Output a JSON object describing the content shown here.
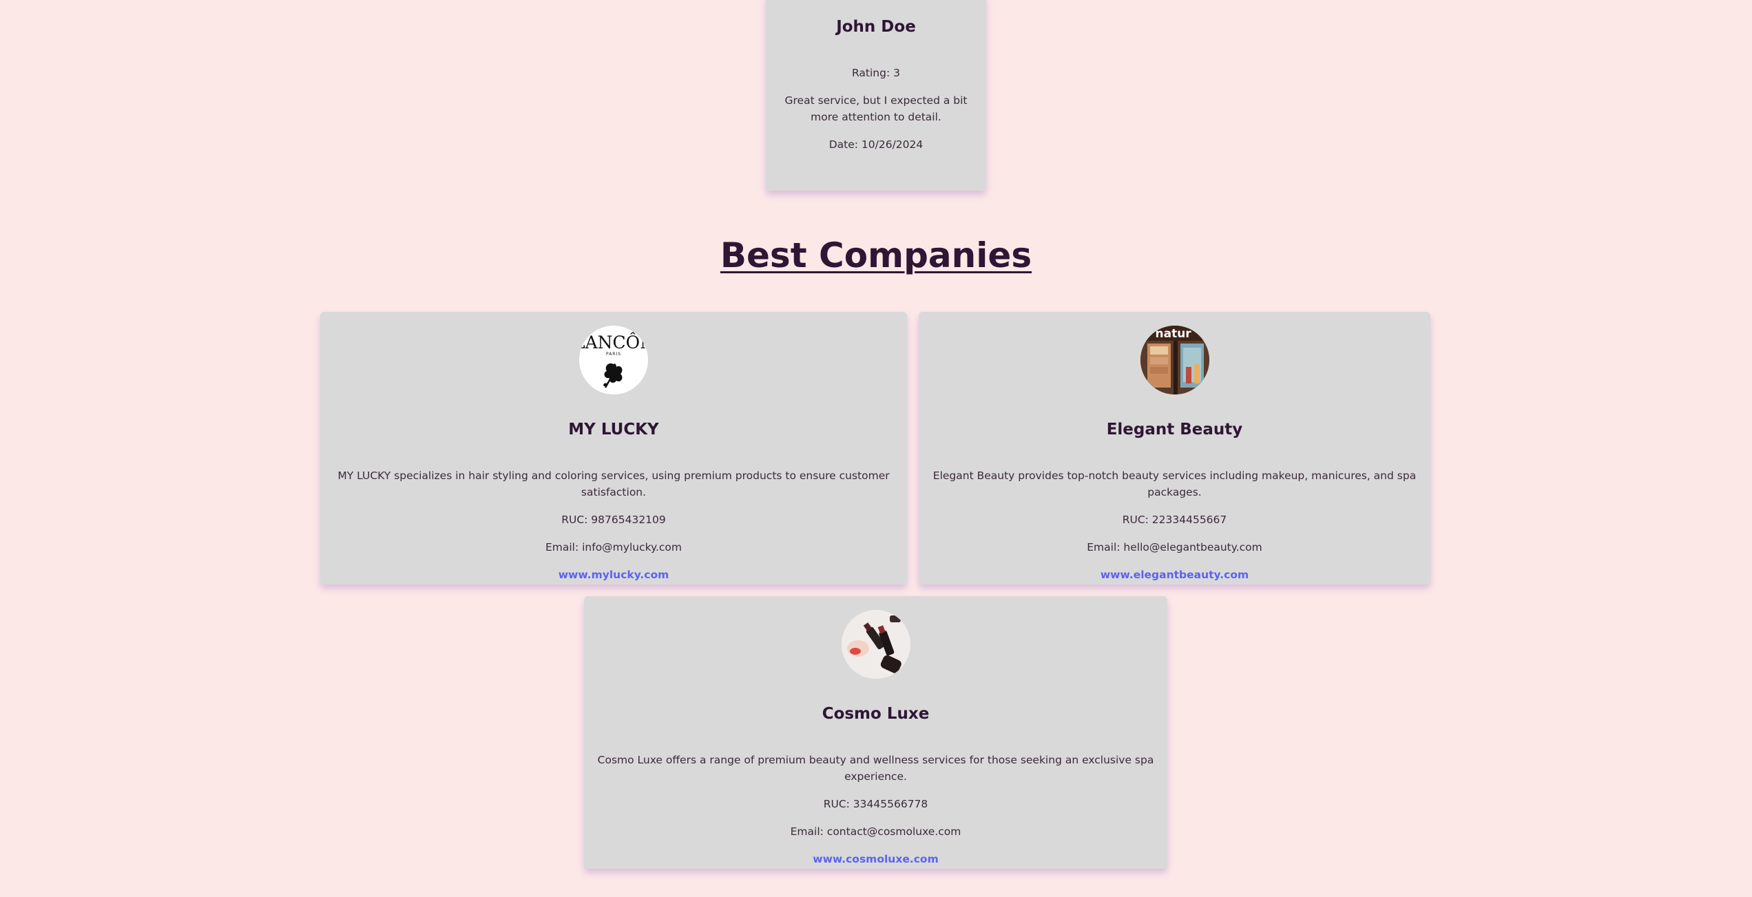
{
  "review": {
    "name": "John Doe",
    "rating": "Rating: 3",
    "comment": "Great service, but I expected a bit more attention to detail.",
    "date": "Date: 10/26/2024"
  },
  "section": {
    "title": "Best Companies"
  },
  "companies": [
    {
      "name": "MY LUCKY",
      "logo_text": "LANCÔME",
      "logo_subtext": "PARIS",
      "description": "MY LUCKY specializes in hair styling and coloring services, using premium products to ensure customer satisfaction.",
      "ruc": "RUC: 98765432109",
      "email": "Email: info@mylucky.com",
      "website": "www.mylucky.com"
    },
    {
      "name": "Elegant Beauty",
      "logo_text": "natur",
      "description": "Elegant Beauty provides top-notch beauty services including makeup, manicures, and spa packages.",
      "ruc": "RUC: 22334455667",
      "email": "Email: hello@elegantbeauty.com",
      "website": "www.elegantbeauty.com"
    },
    {
      "name": "Cosmo Luxe",
      "description": "Cosmo Luxe offers a range of premium beauty and wellness services for those seeking an exclusive spa experience.",
      "ruc": "RUC: 33445566778",
      "email": "Email: contact@cosmoluxe.com",
      "website": "www.cosmoluxe.com"
    }
  ],
  "colors": {
    "background": "#fde8e8",
    "card": "#d9d9d9",
    "heading": "#2e1634",
    "link": "#5b63f0"
  }
}
